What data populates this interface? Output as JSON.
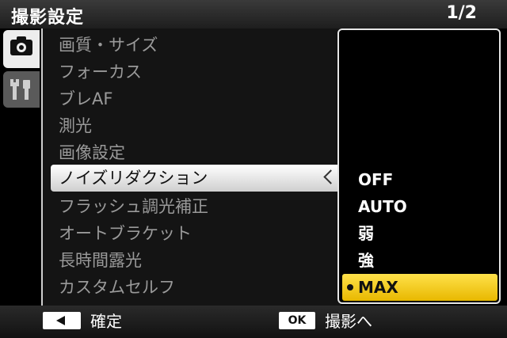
{
  "header": {
    "title": "撮影設定",
    "page": "1/2"
  },
  "tabs": [
    {
      "name": "camera-icon",
      "active": true
    },
    {
      "name": "wrench-screwdriver-icon",
      "active": false
    }
  ],
  "menu": {
    "items": [
      {
        "label": "画質・サイズ"
      },
      {
        "label": "フォーカス"
      },
      {
        "label": "ブレAF"
      },
      {
        "label": "測光"
      },
      {
        "label": "画像設定"
      },
      {
        "label": "ノイズリダクション",
        "selected": true
      },
      {
        "label": "フラッシュ調光補正"
      },
      {
        "label": "オートブラケット"
      },
      {
        "label": "長時間露光"
      },
      {
        "label": "カスタムセルフ"
      }
    ]
  },
  "options": {
    "items": [
      {
        "label": "OFF"
      },
      {
        "label": "AUTO"
      },
      {
        "label": "弱"
      },
      {
        "label": "強"
      },
      {
        "label": "MAX",
        "selected": true
      }
    ]
  },
  "footer": {
    "confirm_label": "確定",
    "ok_key": "OK",
    "to_shooting_label": "撮影へ"
  },
  "colors": {
    "highlight": "#f2c400",
    "selection": "#ffffff"
  }
}
